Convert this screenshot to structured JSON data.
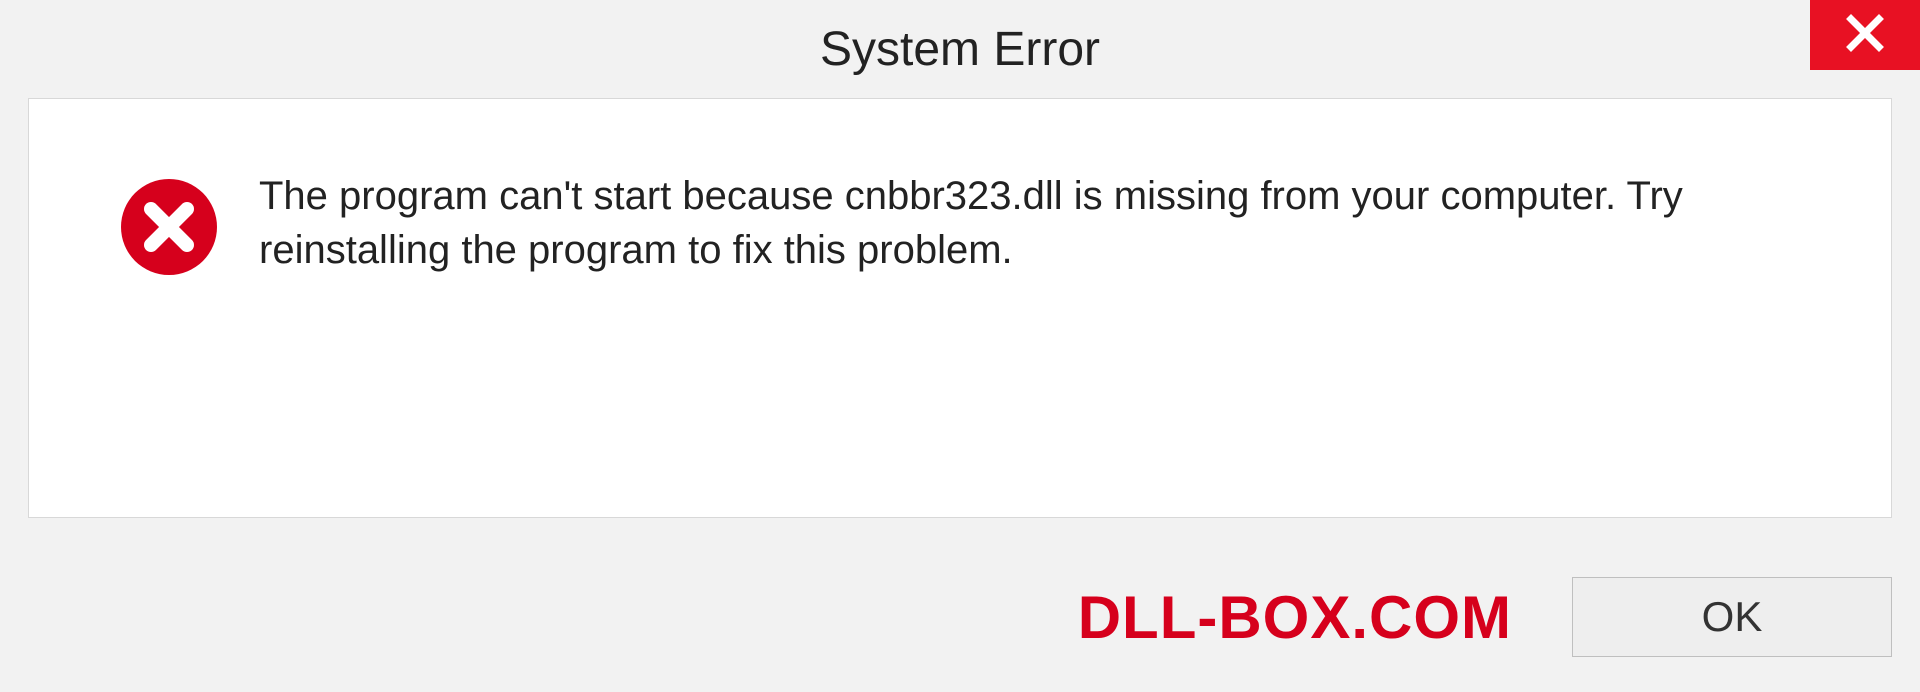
{
  "dialog": {
    "title": "System Error",
    "message": "The program can't start because cnbbr323.dll is missing from your computer. Try reinstalling the program to fix this problem.",
    "ok_label": "OK"
  },
  "watermark": "DLL-BOX.COM"
}
